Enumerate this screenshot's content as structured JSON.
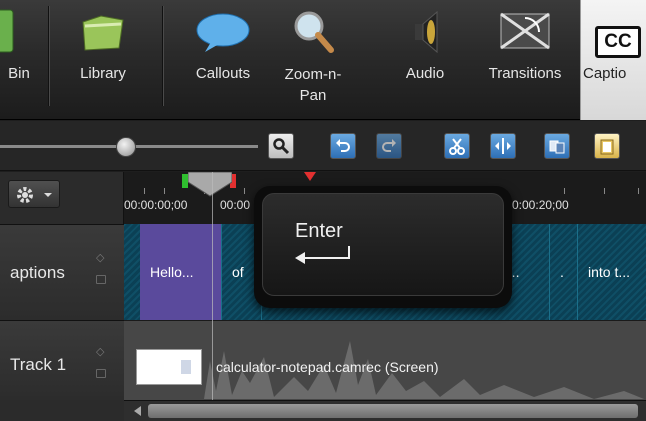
{
  "ribbon": {
    "tools": [
      {
        "label": "Bin",
        "icon": "bin-icon"
      },
      {
        "label": "Library",
        "icon": "library-icon"
      },
      {
        "label": "Callouts",
        "icon": "callouts-icon"
      },
      {
        "label": "Zoom-n-\nPan",
        "label_line1": "Zoom-n-",
        "label_line2": "Pan",
        "icon": "zoom-n-pan-icon"
      },
      {
        "label": "Audio",
        "icon": "audio-icon"
      },
      {
        "label": "Transitions",
        "icon": "transitions-icon"
      },
      {
        "label": "Captions",
        "visible_label": "Captio",
        "icon": "captions-icon",
        "badge": "CC"
      }
    ]
  },
  "toolbar": {
    "zoom_icon": "zoom-search-icon",
    "buttons": [
      "undo-icon",
      "redo-icon",
      "cut-icon",
      "split-icon",
      "copy-icon",
      "paste-icon"
    ]
  },
  "timeline": {
    "timecodes": [
      "00:00:00;00",
      "00:00",
      "0:00:20;00"
    ],
    "tracks": [
      {
        "name": "aptions",
        "full_name": "Captions"
      },
      {
        "name": "Track 1"
      }
    ],
    "captions": [
      "Hello...",
      "of",
      "e...",
      ".",
      "into t..."
    ],
    "screen_clip": "calculator-notepad.camrec (Screen)"
  },
  "keystroke": {
    "label": "Enter"
  },
  "colors": {
    "selected_caption": "#5a4a9c",
    "caption_track": "#0f4f66",
    "accent_blue": "#2e6fb6"
  }
}
